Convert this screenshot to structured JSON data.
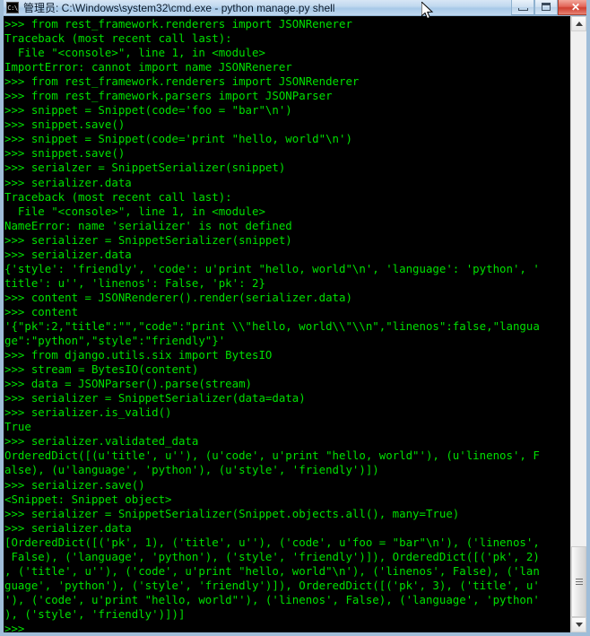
{
  "window": {
    "title": "管理员: C:\\Windows\\system32\\cmd.exe - python  manage.py shell",
    "icon_label": "C:\\",
    "icon_name": "cmd-exe-icon",
    "colors": {
      "console_background": "#000000",
      "console_text": "#00e000",
      "titlebar_gradient_top": "#d7e6f5",
      "titlebar_gradient_bottom": "#bfd7ee",
      "close_button": "#cf3f30",
      "scrollbar_track": "#f0f0f0",
      "scrollbar_thumb": "#e4e4e4"
    },
    "buttons": {
      "minimize": "minimize-button",
      "maximize": "maximize-button",
      "close_label": "✕"
    }
  },
  "scrollbar": {
    "up_arrow": "▲",
    "down_arrow": "▼",
    "thumb_position": "bottom"
  },
  "console": {
    "prompt": ">>>",
    "lines": [
      ">>> from rest_framework.renderers import JSONRenerer",
      "Traceback (most recent call last):",
      "  File \"<console>\", line 1, in <module>",
      "ImportError: cannot import name JSONRenerer",
      ">>> from rest_framework.renderers import JSONRenderer",
      ">>> from rest_framework.parsers import JSONParser",
      ">>> snippet = Snippet(code='foo = \"bar\"\\n')",
      ">>> snippet.save()",
      ">>> snippet = Snippet(code='print \"hello, world\"\\n')",
      ">>> snippet.save()",
      ">>> serialzer = SnippetSerializer(snippet)",
      ">>> serializer.data",
      "Traceback (most recent call last):",
      "  File \"<console>\", line 1, in <module>",
      "NameError: name 'serializer' is not defined",
      ">>> serializer = SnippetSerializer(snippet)",
      ">>> serializer.data",
      "{'style': 'friendly', 'code': u'print \"hello, world\"\\n', 'language': 'python', '",
      "title': u'', 'linenos': False, 'pk': 2}",
      ">>> content = JSONRenderer().render(serializer.data)",
      ">>> content",
      "'{\"pk\":2,\"title\":\"\",\"code\":\"print \\\\\"hello, world\\\\\"\\\\n\",\"linenos\":false,\"langua",
      "ge\":\"python\",\"style\":\"friendly\"}'",
      ">>> from django.utils.six import BytesIO",
      ">>> stream = BytesIO(content)",
      ">>> data = JSONParser().parse(stream)",
      ">>> serializer = SnippetSerializer(data=data)",
      ">>> serializer.is_valid()",
      "True",
      ">>> serializer.validated_data",
      "OrderedDict([(u'title', u''), (u'code', u'print \"hello, world\"'), (u'linenos', F",
      "alse), (u'language', 'python'), (u'style', 'friendly')])",
      ">>> serializer.save()",
      "<Snippet: Snippet object>",
      ">>> serializer = SnippetSerializer(Snippet.objects.all(), many=True)",
      ">>> serializer.data",
      "[OrderedDict([('pk', 1), ('title', u''), ('code', u'foo = \"bar\"\\n'), ('linenos',",
      " False), ('language', 'python'), ('style', 'friendly')]), OrderedDict([('pk', 2)",
      ", ('title', u''), ('code', u'print \"hello, world\"\\n'), ('linenos', False), ('lan",
      "guage', 'python'), ('style', 'friendly')]), OrderedDict([('pk', 3), ('title', u'",
      "'), ('code', u'print \"hello, world\"'), ('linenos', False), ('language', 'python'",
      "), ('style', 'friendly')])]",
      ">>>"
    ]
  }
}
